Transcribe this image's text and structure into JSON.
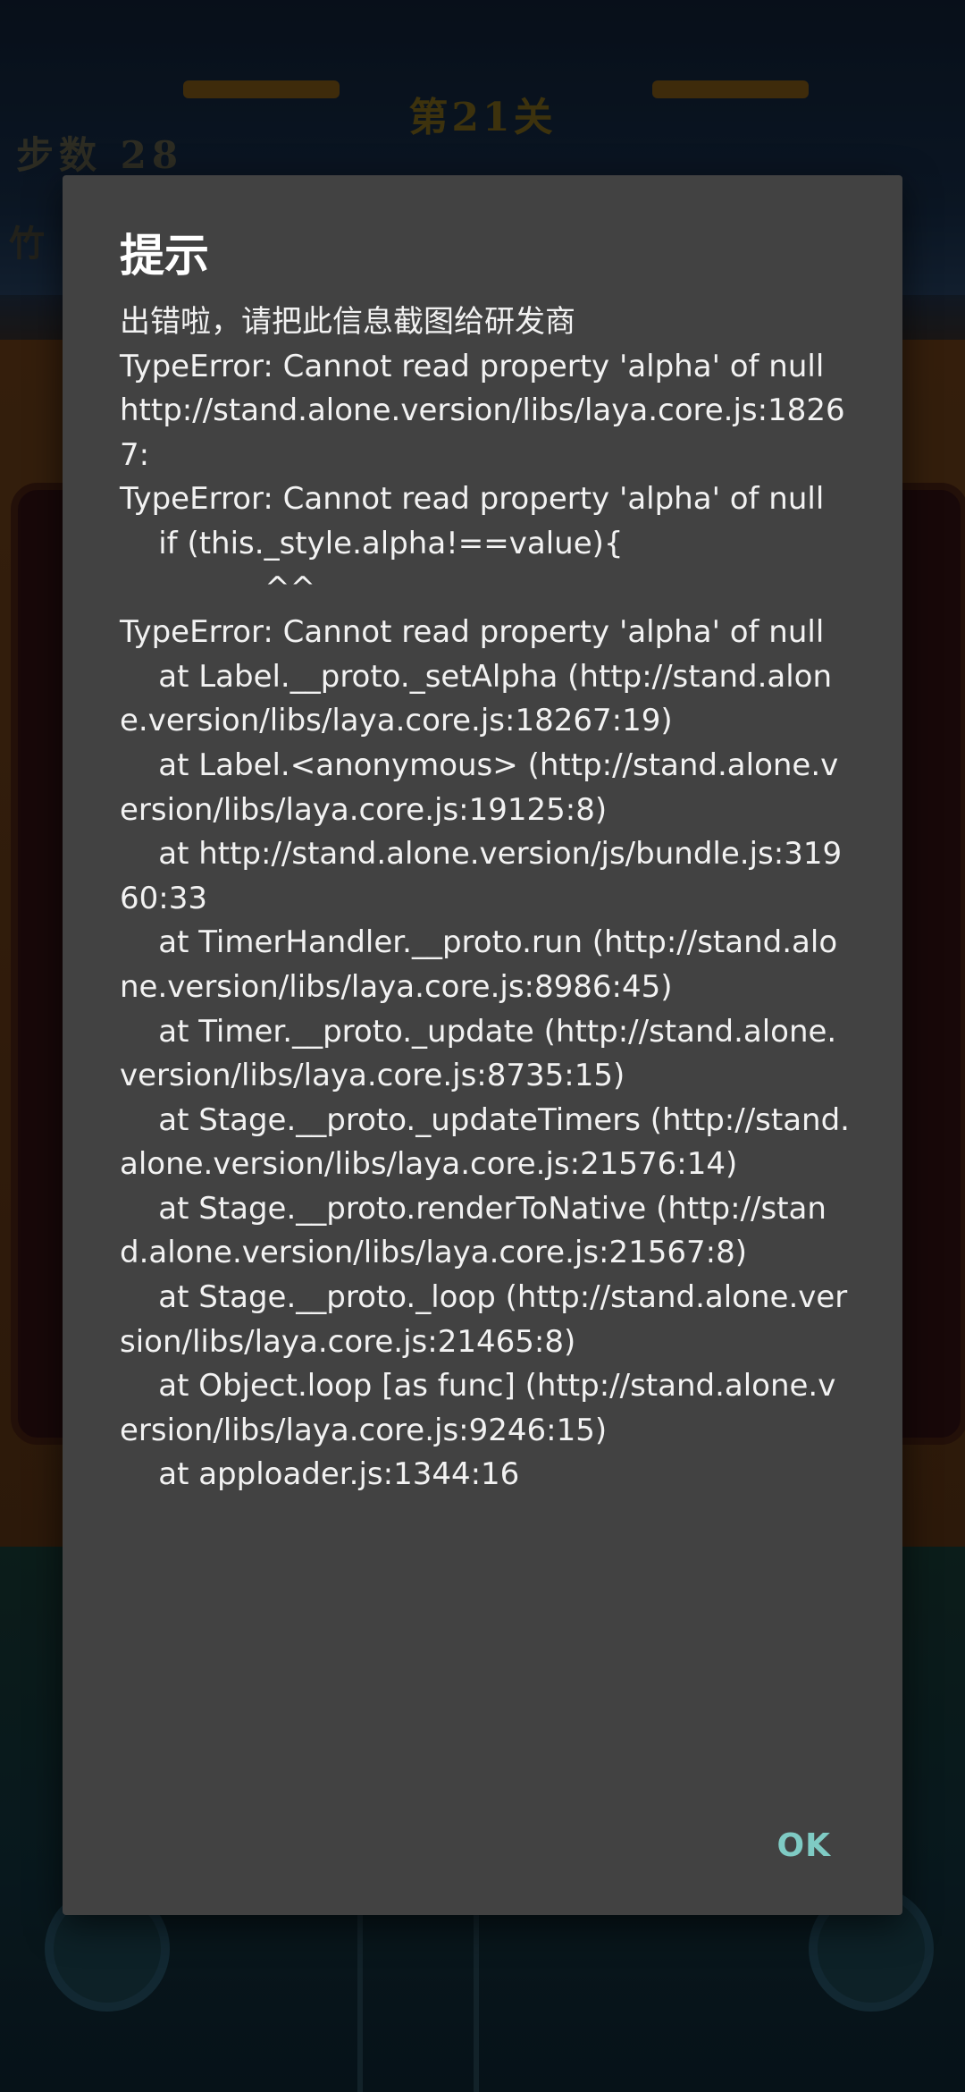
{
  "background": {
    "level_title": "第21关",
    "steps_text": "步数 28",
    "goal_glyph": "竹"
  },
  "dialog": {
    "title": "提示",
    "message": "出错啦，请把此信息截图给研发商\nTypeError: Cannot read property 'alpha' of null\nhttp://stand.alone.version/libs/laya.core.js:18267:\nTypeError: Cannot read property 'alpha' of null\n    if (this._style.alpha!==value){\n               ^^\nTypeError: Cannot read property 'alpha' of null\n    at Label.__proto._setAlpha (http://stand.alone.version/libs/laya.core.js:18267:19)\n    at Label.<anonymous> (http://stand.alone.version/libs/laya.core.js:19125:8)\n    at http://stand.alone.version/js/bundle.js:31960:33\n    at TimerHandler.__proto.run (http://stand.alone.version/libs/laya.core.js:8986:45)\n    at Timer.__proto._update (http://stand.alone.version/libs/laya.core.js:8735:15)\n    at Stage.__proto._updateTimers (http://stand.alone.version/libs/laya.core.js:21576:14)\n    at Stage.__proto.renderToNative (http://stand.alone.version/libs/laya.core.js:21567:8)\n    at Stage.__proto._loop (http://stand.alone.version/libs/laya.core.js:21465:8)\n    at Object.loop [as func] (http://stand.alone.version/libs/laya.core.js:9246:15)\n    at apploader.js:1344:16",
    "ok_label": "OK"
  },
  "colors": {
    "dialog_bg": "#424242",
    "accent": "#7fcbc4",
    "text": "#f2f2f2"
  }
}
